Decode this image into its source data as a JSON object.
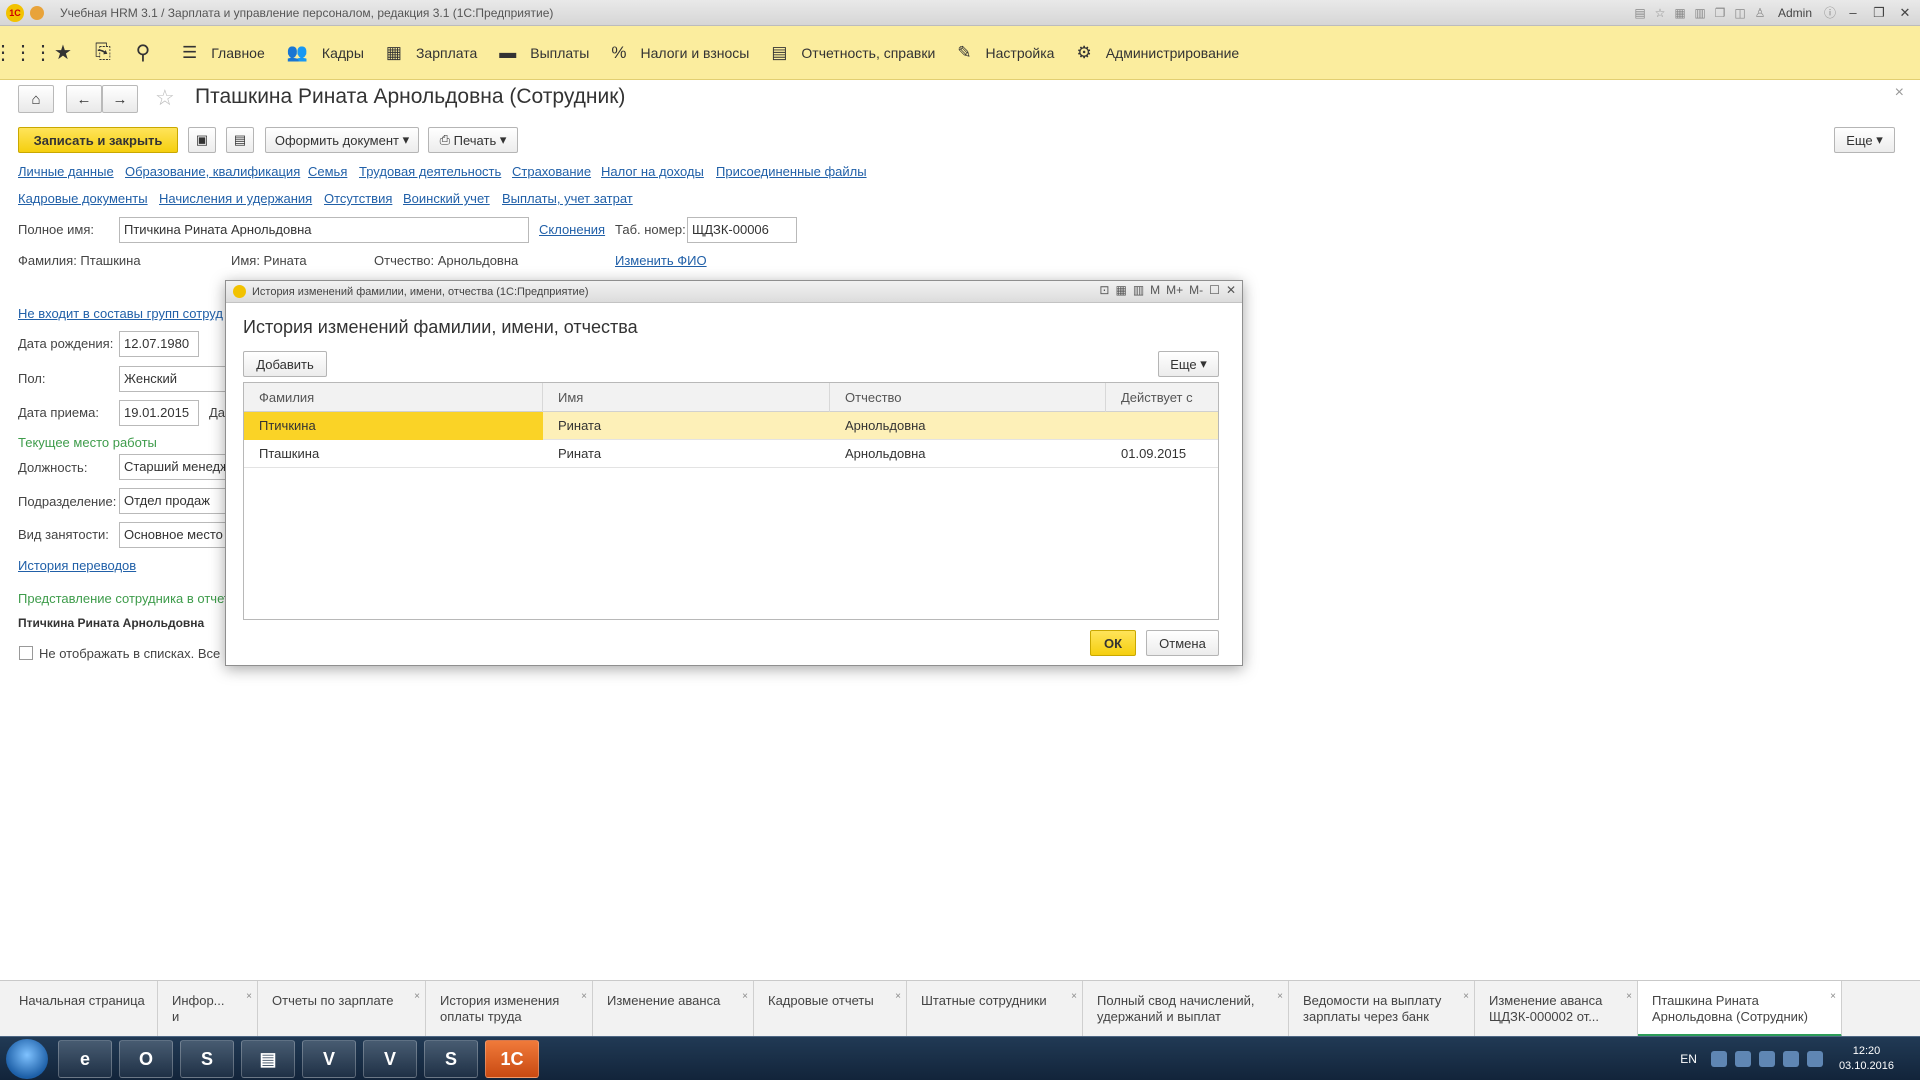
{
  "window": {
    "title": "Учебная HRM 3.1 / Зарплата и управление персоналом, редакция 3.1  (1С:Предприятие)",
    "logo_text": "1С",
    "user": "Admin"
  },
  "sections": [
    {
      "label": "Главное",
      "icon": "menu-lines-icon",
      "glyph": "☰"
    },
    {
      "label": "Кадры",
      "icon": "people-icon",
      "glyph": "👥"
    },
    {
      "label": "Зарплата",
      "icon": "calculator-icon",
      "glyph": "▦"
    },
    {
      "label": "Выплаты",
      "icon": "wallet-icon",
      "glyph": "▬"
    },
    {
      "label": "Налоги и взносы",
      "icon": "percent-icon",
      "glyph": "%"
    },
    {
      "label": "Отчетность, справки",
      "icon": "documents-icon",
      "glyph": "▤"
    },
    {
      "label": "Настройка",
      "icon": "wrench-icon",
      "glyph": "✎"
    },
    {
      "label": "Администрирование",
      "icon": "gear-icon",
      "glyph": "⚙"
    }
  ],
  "form": {
    "title": "Пташкина Рината Арнольдовна (Сотрудник)",
    "save_close": "Записать и закрыть",
    "make_document": "Оформить документ",
    "print": "Печать",
    "more": "Еще",
    "links_row1": [
      "Личные данные",
      "Образование, квалификация",
      "Семья",
      "Трудовая деятельность",
      "Страхование",
      "Налог на доходы",
      "Присоединенные файлы"
    ],
    "links_row2": [
      "Кадровые документы",
      "Начисления и удержания",
      "Отсутствия",
      "Воинский учет",
      "Выплаты, учет затрат"
    ],
    "full_name_label": "Полное имя:",
    "full_name_value": "Птичкина Рината Арнольдовна",
    "declensions": "Склонения",
    "tab_number_label": "Таб. номер:",
    "tab_number_value": "ЩДЗК-00006",
    "surname_text": "Фамилия: Пташкина",
    "name_text": "Имя: Рината",
    "patronymic_text": "Отчество: Арнольдовна",
    "change_fio": "Изменить ФИО",
    "groups_link": "Не входит в составы групп сотруд",
    "birth_label": "Дата рождения:",
    "birth_value": "12.07.1980",
    "sex_label": "Пол:",
    "sex_value": "Женский",
    "hire_label": "Дата приема:",
    "hire_value": "19.01.2015",
    "hire_extra": "Да",
    "workplace_header": "Текущее место работы",
    "position_label": "Должность:",
    "position_value": "Старший менедж",
    "department_label": "Подразделение:",
    "department_value": "Отдел продаж",
    "employment_label": "Вид занятости:",
    "employment_value": "Основное место",
    "transfers_link": "История переводов",
    "repr_header": "Представление сотрудника в отчет",
    "repr_value": "Птичкина Рината Арнольдовна",
    "hide_checkbox": "Не отображать в списках. Все"
  },
  "dialog": {
    "window_title": "История изменений фамилии, имени, отчества  (1С:Предприятие)",
    "title": "История изменений фамилии, имени, отчества",
    "add": "Добавить",
    "more": "Еще",
    "columns": [
      "Фамилия",
      "Имя",
      "Отчество",
      "Действует с"
    ],
    "rows": [
      {
        "surname": "Птичкина",
        "name": "Рината",
        "patronymic": "Арнольдовна",
        "since": ""
      },
      {
        "surname": "Пташкина",
        "name": "Рината",
        "patronymic": "Арнольдовна",
        "since": "01.09.2015"
      }
    ],
    "ok": "ОК",
    "cancel": "Отмена",
    "head_tools": [
      "M",
      "M+",
      "M-"
    ]
  },
  "tabs": [
    "Начальная страница",
    "Инфор...\nи",
    "Отчеты по зарплате",
    "История изменения\nоплаты труда",
    "Изменение аванса",
    "Кадровые отчеты",
    "Штатные сотрудники",
    "Полный свод начислений,\nудержаний и выплат",
    "Ведомости на выплату\nзарплаты через банк",
    "Изменение аванса\nЩДЗК-000002 от...",
    "Пташкина Рината\nАрнольдовна (Сотрудник)"
  ],
  "taskbar": {
    "lang": "EN",
    "time": "12:20",
    "date": "03.10.2016",
    "apps": [
      "e",
      "O",
      "S",
      "▤",
      "V",
      "V",
      "S",
      "1С"
    ]
  },
  "colors": {
    "accent_yellow": "#fad326",
    "section_bar": "#fbed9e",
    "link_blue": "#2160a8",
    "green_header": "#3e9c4b"
  }
}
